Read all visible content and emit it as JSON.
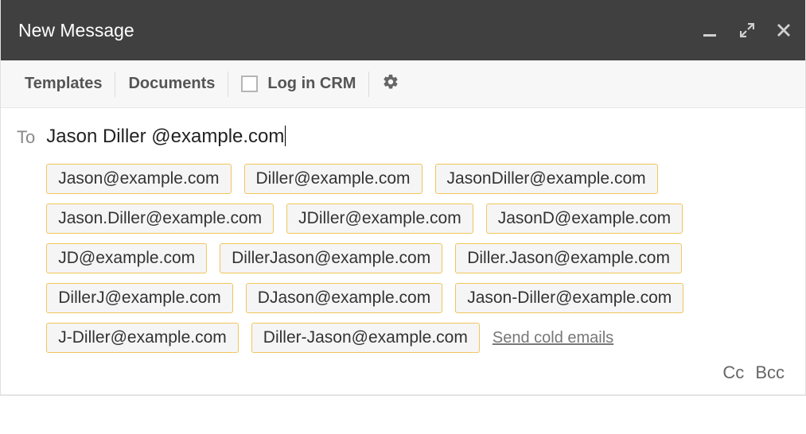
{
  "titlebar": {
    "title": "New Message"
  },
  "toolbar": {
    "templates": "Templates",
    "documents": "Documents",
    "logInCrm": "Log in CRM"
  },
  "recipients": {
    "toLabel": "To",
    "inputValue": "Jason Diller @example.com",
    "coldEmailsLink": "Send cold emails",
    "ccLabel": "Cc",
    "bccLabel": "Bcc",
    "suggestions": [
      "Jason@example.com",
      "Diller@example.com",
      "JasonDiller@example.com",
      "Jason.Diller@example.com",
      "JDiller@example.com",
      "JasonD@example.com",
      "JD@example.com",
      "DillerJason@example.com",
      "Diller.Jason@example.com",
      "DillerJ@example.com",
      "DJason@example.com",
      "Jason-Diller@example.com",
      "J-Diller@example.com",
      "Diller-Jason@example.com"
    ]
  }
}
